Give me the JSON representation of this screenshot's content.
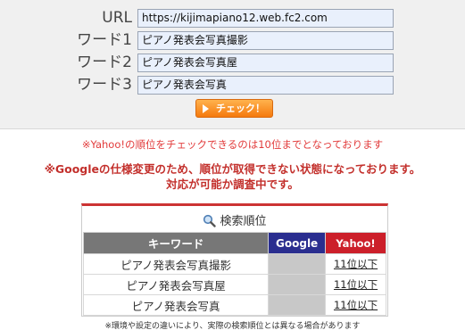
{
  "form": {
    "rows": [
      {
        "label": "URL",
        "value": "https://kijimapiano12.web.fc2.com"
      },
      {
        "label": "ワード1",
        "value": "ピアノ発表会写真撮影"
      },
      {
        "label": "ワード2",
        "value": "ピアノ発表会写真屋"
      },
      {
        "label": "ワード3",
        "value": "ピアノ発表会写真"
      }
    ],
    "check_label": "チェック！"
  },
  "notices": {
    "yahoo_note": "※Yahoo!の順位をチェックできるのは10位までとなっております",
    "google_line1": "※Googleの仕様変更のため、順位が取得できない状態になっております。",
    "google_line2": "対応が可能か調査中です。"
  },
  "ranking": {
    "title": "検索順位",
    "headers": {
      "keyword": "キーワード",
      "google": "Google",
      "yahoo": "Yahoo!"
    },
    "rows": [
      {
        "keyword": "ピアノ発表会写真撮影",
        "google": "",
        "yahoo": "11位以下"
      },
      {
        "keyword": "ピアノ発表会写真屋",
        "google": "",
        "yahoo": "11位以下"
      },
      {
        "keyword": "ピアノ発表会写真",
        "google": "",
        "yahoo": "11位以下"
      }
    ]
  },
  "footnote": "※環境や設定の違いにより、実際の検索順位とは異なる場合があります",
  "colors": {
    "accent_red": "#cc1f2a",
    "google_blue": "#2a2e8f",
    "button_orange": "#f57a0e"
  },
  "icons": {
    "title_icon": "magnifier-icon",
    "button_icon": "play-arrow-icon"
  }
}
